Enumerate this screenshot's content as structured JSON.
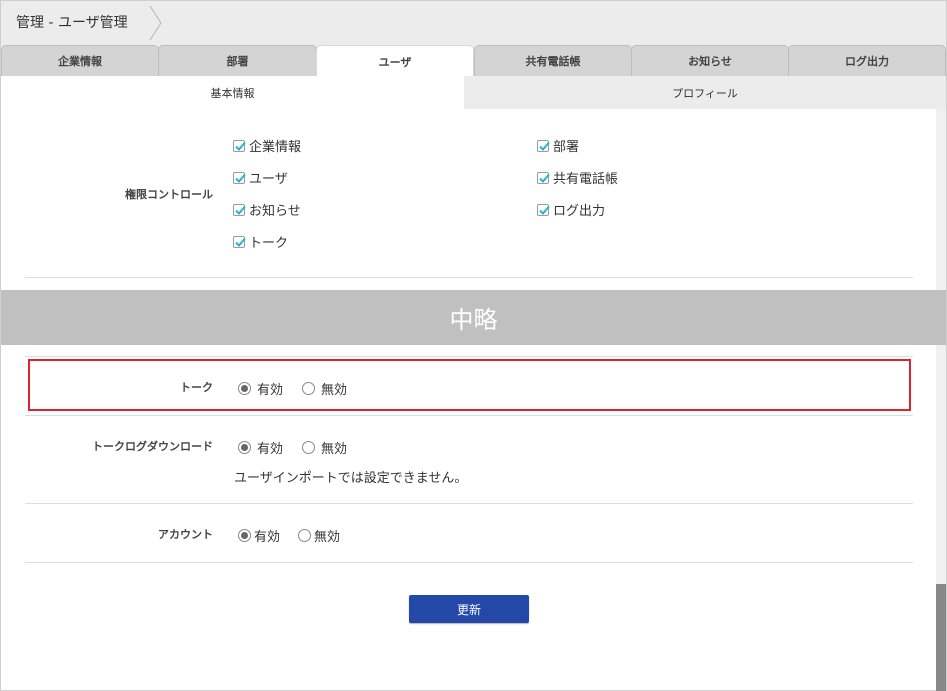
{
  "header": {
    "title": "管理 - ユーザ管理"
  },
  "tabs": [
    {
      "label": "企業情報"
    },
    {
      "label": "部署"
    },
    {
      "label": "ユーザ"
    },
    {
      "label": "共有電話帳"
    },
    {
      "label": "お知らせ"
    },
    {
      "label": "ログ出力"
    }
  ],
  "active_tab": "ユーザ",
  "subtabs": [
    {
      "label": "基本情報"
    },
    {
      "label": "プロフィール"
    }
  ],
  "active_subtab": "基本情報",
  "permissions": {
    "label": "権限コントロール",
    "items": [
      {
        "label": "企業情報",
        "checked": true
      },
      {
        "label": "部署",
        "checked": true
      },
      {
        "label": "ユーザ",
        "checked": true
      },
      {
        "label": "共有電話帳",
        "checked": true
      },
      {
        "label": "お知らせ",
        "checked": true
      },
      {
        "label": "ログ出力",
        "checked": true
      },
      {
        "label": "トーク",
        "checked": true
      }
    ]
  },
  "omission": "中略",
  "settings": [
    {
      "label": "トーク",
      "options": [
        "有効",
        "無効"
      ],
      "selected": "有効"
    },
    {
      "label": "トークログダウンロード",
      "options": [
        "有効",
        "無効"
      ],
      "selected": "有効",
      "note": "ユーザインポートでは設定できません。"
    },
    {
      "label": "アカウント",
      "options": [
        "有効",
        "無効"
      ],
      "selected": "有効"
    }
  ],
  "buttons": {
    "update": "更新"
  },
  "colors": {
    "checkmark": "#2ab3c6",
    "primary_button": "#2348a8",
    "highlight_border": "#d9262e",
    "omission_band": "#c0c0c0"
  }
}
